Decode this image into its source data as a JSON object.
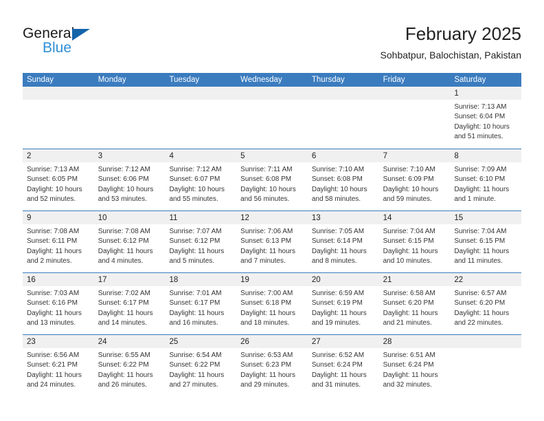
{
  "logo": {
    "word_one": "General",
    "word_two": "Blue",
    "triangle_color": "#1464aa",
    "blue_color": "#2f8fd6"
  },
  "header": {
    "title": "February 2025",
    "subtitle": "Sohbatpur, Balochistan, Pakistan"
  },
  "theme": {
    "header_blue": "#3b7cbf",
    "day_strip_gray": "#f0f0f0",
    "text_color": "#333333"
  },
  "weekdays": [
    "Sunday",
    "Monday",
    "Tuesday",
    "Wednesday",
    "Thursday",
    "Friday",
    "Saturday"
  ],
  "labels": {
    "sunrise": "Sunrise:",
    "sunset": "Sunset:",
    "daylight": "Daylight:"
  },
  "weeks": [
    [
      {
        "day": "",
        "sunrise": "",
        "sunset": "",
        "daylight": "",
        "empty": true
      },
      {
        "day": "",
        "sunrise": "",
        "sunset": "",
        "daylight": "",
        "empty": true
      },
      {
        "day": "",
        "sunrise": "",
        "sunset": "",
        "daylight": "",
        "empty": true
      },
      {
        "day": "",
        "sunrise": "",
        "sunset": "",
        "daylight": "",
        "empty": true
      },
      {
        "day": "",
        "sunrise": "",
        "sunset": "",
        "daylight": "",
        "empty": true
      },
      {
        "day": "",
        "sunrise": "",
        "sunset": "",
        "daylight": "",
        "empty": true
      },
      {
        "day": "1",
        "sunrise": "Sunrise: 7:13 AM",
        "sunset": "Sunset: 6:04 PM",
        "daylight": "Daylight: 10 hours and 51 minutes.",
        "empty": false
      }
    ],
    [
      {
        "day": "2",
        "sunrise": "Sunrise: 7:13 AM",
        "sunset": "Sunset: 6:05 PM",
        "daylight": "Daylight: 10 hours and 52 minutes.",
        "empty": false
      },
      {
        "day": "3",
        "sunrise": "Sunrise: 7:12 AM",
        "sunset": "Sunset: 6:06 PM",
        "daylight": "Daylight: 10 hours and 53 minutes.",
        "empty": false
      },
      {
        "day": "4",
        "sunrise": "Sunrise: 7:12 AM",
        "sunset": "Sunset: 6:07 PM",
        "daylight": "Daylight: 10 hours and 55 minutes.",
        "empty": false
      },
      {
        "day": "5",
        "sunrise": "Sunrise: 7:11 AM",
        "sunset": "Sunset: 6:08 PM",
        "daylight": "Daylight: 10 hours and 56 minutes.",
        "empty": false
      },
      {
        "day": "6",
        "sunrise": "Sunrise: 7:10 AM",
        "sunset": "Sunset: 6:08 PM",
        "daylight": "Daylight: 10 hours and 58 minutes.",
        "empty": false
      },
      {
        "day": "7",
        "sunrise": "Sunrise: 7:10 AM",
        "sunset": "Sunset: 6:09 PM",
        "daylight": "Daylight: 10 hours and 59 minutes.",
        "empty": false
      },
      {
        "day": "8",
        "sunrise": "Sunrise: 7:09 AM",
        "sunset": "Sunset: 6:10 PM",
        "daylight": "Daylight: 11 hours and 1 minute.",
        "empty": false
      }
    ],
    [
      {
        "day": "9",
        "sunrise": "Sunrise: 7:08 AM",
        "sunset": "Sunset: 6:11 PM",
        "daylight": "Daylight: 11 hours and 2 minutes.",
        "empty": false
      },
      {
        "day": "10",
        "sunrise": "Sunrise: 7:08 AM",
        "sunset": "Sunset: 6:12 PM",
        "daylight": "Daylight: 11 hours and 4 minutes.",
        "empty": false
      },
      {
        "day": "11",
        "sunrise": "Sunrise: 7:07 AM",
        "sunset": "Sunset: 6:12 PM",
        "daylight": "Daylight: 11 hours and 5 minutes.",
        "empty": false
      },
      {
        "day": "12",
        "sunrise": "Sunrise: 7:06 AM",
        "sunset": "Sunset: 6:13 PM",
        "daylight": "Daylight: 11 hours and 7 minutes.",
        "empty": false
      },
      {
        "day": "13",
        "sunrise": "Sunrise: 7:05 AM",
        "sunset": "Sunset: 6:14 PM",
        "daylight": "Daylight: 11 hours and 8 minutes.",
        "empty": false
      },
      {
        "day": "14",
        "sunrise": "Sunrise: 7:04 AM",
        "sunset": "Sunset: 6:15 PM",
        "daylight": "Daylight: 11 hours and 10 minutes.",
        "empty": false
      },
      {
        "day": "15",
        "sunrise": "Sunrise: 7:04 AM",
        "sunset": "Sunset: 6:15 PM",
        "daylight": "Daylight: 11 hours and 11 minutes.",
        "empty": false
      }
    ],
    [
      {
        "day": "16",
        "sunrise": "Sunrise: 7:03 AM",
        "sunset": "Sunset: 6:16 PM",
        "daylight": "Daylight: 11 hours and 13 minutes.",
        "empty": false
      },
      {
        "day": "17",
        "sunrise": "Sunrise: 7:02 AM",
        "sunset": "Sunset: 6:17 PM",
        "daylight": "Daylight: 11 hours and 14 minutes.",
        "empty": false
      },
      {
        "day": "18",
        "sunrise": "Sunrise: 7:01 AM",
        "sunset": "Sunset: 6:17 PM",
        "daylight": "Daylight: 11 hours and 16 minutes.",
        "empty": false
      },
      {
        "day": "19",
        "sunrise": "Sunrise: 7:00 AM",
        "sunset": "Sunset: 6:18 PM",
        "daylight": "Daylight: 11 hours and 18 minutes.",
        "empty": false
      },
      {
        "day": "20",
        "sunrise": "Sunrise: 6:59 AM",
        "sunset": "Sunset: 6:19 PM",
        "daylight": "Daylight: 11 hours and 19 minutes.",
        "empty": false
      },
      {
        "day": "21",
        "sunrise": "Sunrise: 6:58 AM",
        "sunset": "Sunset: 6:20 PM",
        "daylight": "Daylight: 11 hours and 21 minutes.",
        "empty": false
      },
      {
        "day": "22",
        "sunrise": "Sunrise: 6:57 AM",
        "sunset": "Sunset: 6:20 PM",
        "daylight": "Daylight: 11 hours and 22 minutes.",
        "empty": false
      }
    ],
    [
      {
        "day": "23",
        "sunrise": "Sunrise: 6:56 AM",
        "sunset": "Sunset: 6:21 PM",
        "daylight": "Daylight: 11 hours and 24 minutes.",
        "empty": false
      },
      {
        "day": "24",
        "sunrise": "Sunrise: 6:55 AM",
        "sunset": "Sunset: 6:22 PM",
        "daylight": "Daylight: 11 hours and 26 minutes.",
        "empty": false
      },
      {
        "day": "25",
        "sunrise": "Sunrise: 6:54 AM",
        "sunset": "Sunset: 6:22 PM",
        "daylight": "Daylight: 11 hours and 27 minutes.",
        "empty": false
      },
      {
        "day": "26",
        "sunrise": "Sunrise: 6:53 AM",
        "sunset": "Sunset: 6:23 PM",
        "daylight": "Daylight: 11 hours and 29 minutes.",
        "empty": false
      },
      {
        "day": "27",
        "sunrise": "Sunrise: 6:52 AM",
        "sunset": "Sunset: 6:24 PM",
        "daylight": "Daylight: 11 hours and 31 minutes.",
        "empty": false
      },
      {
        "day": "28",
        "sunrise": "Sunrise: 6:51 AM",
        "sunset": "Sunset: 6:24 PM",
        "daylight": "Daylight: 11 hours and 32 minutes.",
        "empty": false
      },
      {
        "day": "",
        "sunrise": "",
        "sunset": "",
        "daylight": "",
        "empty": true
      }
    ]
  ]
}
